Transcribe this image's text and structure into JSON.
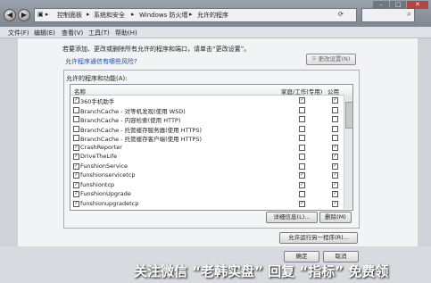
{
  "address": {
    "segments": [
      "控制面板",
      "系统和安全",
      "Windows 防火墙",
      "允许的程序"
    ],
    "search_placeholder": ""
  },
  "menu": [
    "文件(F)",
    "编辑(E)",
    "查看(V)",
    "工具(T)",
    "帮助(H)"
  ],
  "intro": "若要添加、更改或删除所有允许的程序和端口，请单击“更改设置”。",
  "risk_link": "允许程序通信有哪些风险?",
  "change_settings_label": "更改设置(N)",
  "group_label": "允许的程序和功能(A):",
  "columns": {
    "name": "名称",
    "home": "家庭/工作(专用)",
    "public": "公用"
  },
  "rows": [
    {
      "name": "360手机助手",
      "checked": true,
      "home": true,
      "public": true
    },
    {
      "name": "BranchCache - 对等机发现(使用 WSD)",
      "checked": false,
      "home": false,
      "public": false
    },
    {
      "name": "BranchCache - 内容检索(使用 HTTP)",
      "checked": false,
      "home": false,
      "public": false
    },
    {
      "name": "BranchCache - 托管缓存服务器(使用 HTTPS)",
      "checked": false,
      "home": false,
      "public": false
    },
    {
      "name": "BranchCache - 托管缓存客户端(使用 HTTPS)",
      "checked": false,
      "home": false,
      "public": false
    },
    {
      "name": "CrashReporter",
      "checked": true,
      "home": false,
      "public": true
    },
    {
      "name": "DriveTheLife",
      "checked": true,
      "home": false,
      "public": true
    },
    {
      "name": "FunshionService",
      "checked": true,
      "home": false,
      "public": true
    },
    {
      "name": "funshionservicetcp",
      "checked": true,
      "home": true,
      "public": true
    },
    {
      "name": "funshiontcp",
      "checked": true,
      "home": true,
      "public": true
    },
    {
      "name": "FunshionUpgrade",
      "checked": true,
      "home": false,
      "public": true
    },
    {
      "name": "funshionupgradetcp",
      "checked": true,
      "home": true,
      "public": true
    }
  ],
  "details_label": "详细信息(L)...",
  "remove_label": "删除(M)",
  "allow_other_label": "允许运行另一程序(R)...",
  "ok_label": "确定",
  "cancel_label": "取消",
  "watermark": "关注微信 “老韩实盘” 回复 “指标” 免费领"
}
